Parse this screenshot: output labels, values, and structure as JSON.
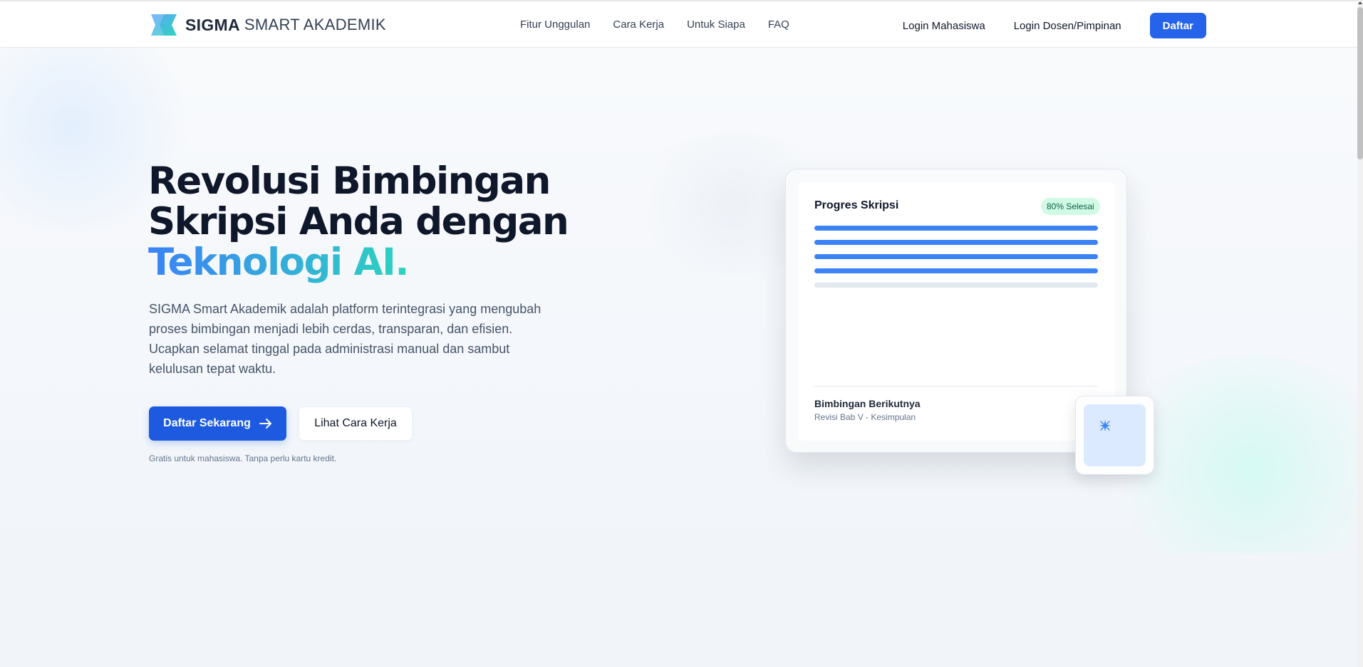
{
  "brand": {
    "name_bold": "SIGMA",
    "name_light": "SMART AKADEMIK",
    "logo_icon": "sigma-flag-icon",
    "colors": {
      "logo_start": "#60a5fa",
      "logo_end": "#2dd4bf"
    }
  },
  "nav": {
    "links": [
      "Fitur Unggulan",
      "Cara Kerja",
      "Untuk Siapa",
      "FAQ"
    ],
    "login_mahasiswa": "Login Mahasiswa",
    "login_dosen": "Login Dosen/Pimpinan",
    "daftar": "Daftar"
  },
  "hero": {
    "headline_line1": "Revolusi Bimbingan",
    "headline_line2": "Skripsi Anda dengan",
    "headline_accent": "Teknologi AI.",
    "description": "SIGMA Smart Akademik adalah platform terintegrasi yang mengubah proses bimbingan menjadi lebih cerdas, transparan, dan efisien. Ucapkan selamat tinggal pada administrasi manual dan sambut kelulusan tepat waktu.",
    "cta_primary": "Daftar Sekarang",
    "cta_primary_icon": "arrow-right-icon",
    "cta_secondary": "Lihat Cara Kerja",
    "fineprint": "Gratis untuk mahasiswa. Tanpa perlu kartu kredit."
  },
  "progress_card": {
    "title": "Progres Skripsi",
    "badge": "80% Selesai",
    "progress_fraction": 0.8,
    "bars_done": 4,
    "bars_total": 5,
    "next_title": "Bimbingan Berikutnya",
    "next_subtitle": "Revisi Bab V - Kesimpulan"
  },
  "float_card": {
    "icon": "sparkle-icon"
  },
  "colors": {
    "accent": "#2563eb",
    "bar_done": "#3b82f6",
    "bar_todo": "#e2e8f0",
    "badge_bg": "#d1fae5",
    "badge_text": "#065f46"
  }
}
